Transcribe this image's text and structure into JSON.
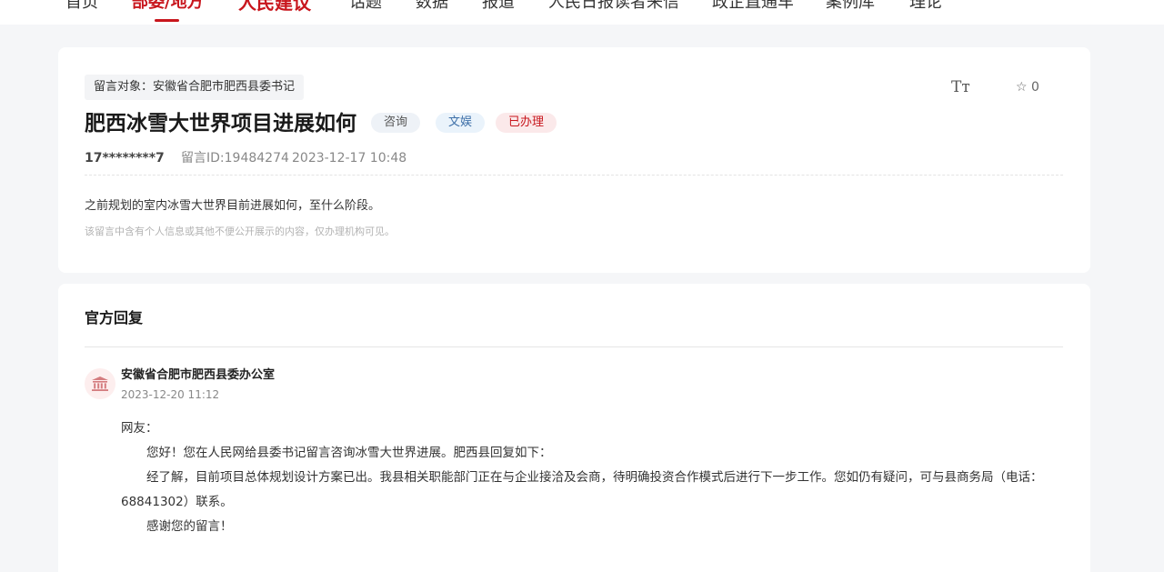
{
  "nav": {
    "items": [
      {
        "label": "首页",
        "state": "normal"
      },
      {
        "label": "部委/地方",
        "state": "active"
      },
      {
        "label": "人民建议",
        "state": "brand"
      },
      {
        "label": "话题",
        "state": "normal"
      },
      {
        "label": "数据",
        "state": "normal"
      },
      {
        "label": "报道",
        "state": "normal"
      },
      {
        "label": "人民日报读者来信",
        "state": "normal"
      },
      {
        "label": "政企直通车",
        "state": "normal"
      },
      {
        "label": "案例库",
        "state": "normal"
      },
      {
        "label": "理论",
        "state": "normal"
      }
    ]
  },
  "message": {
    "target": "留言对象：安徽省合肥市肥西县委书记",
    "title": "肥西冰雪大世界项目进展如何",
    "badges": {
      "type": "咨询",
      "domain": "文娱",
      "status": "已办理"
    },
    "tools": {
      "font_icon": "Tт",
      "favorite_icon": "☆",
      "favorite_count": "0"
    },
    "user": "17********7",
    "message_id": "留言ID:19484274",
    "time": "2023-12-17 10:48",
    "content": "之前规划的室内冰雪大世界目前进展如何，至什么阶段。",
    "privacy_note": "该留言中含有个人信息或其他不便公开展示的内容，仅办理机构可见。"
  },
  "reply": {
    "heading": "官方回复",
    "org_name": "安徽省合肥市肥西县委办公室",
    "org_time": "2023-12-20 11:12",
    "salutation": "网友：",
    "paragraph1": "您好！您在人民网给县委书记留言咨询冰雪大世界进展。肥西县回复如下：",
    "paragraph2": "经了解，目前项目总体规划设计方案已出。我县相关职能部门正在与企业接洽及会商，待明确投资合作模式后进行下一步工作。您如仍有疑问，可与县商务局（电话：68841302）联系。",
    "paragraph3": "感谢您的留言！"
  },
  "colors": {
    "accent": "#c8161d",
    "page_bg": "#f5f6f8",
    "card_bg": "#ffffff"
  }
}
